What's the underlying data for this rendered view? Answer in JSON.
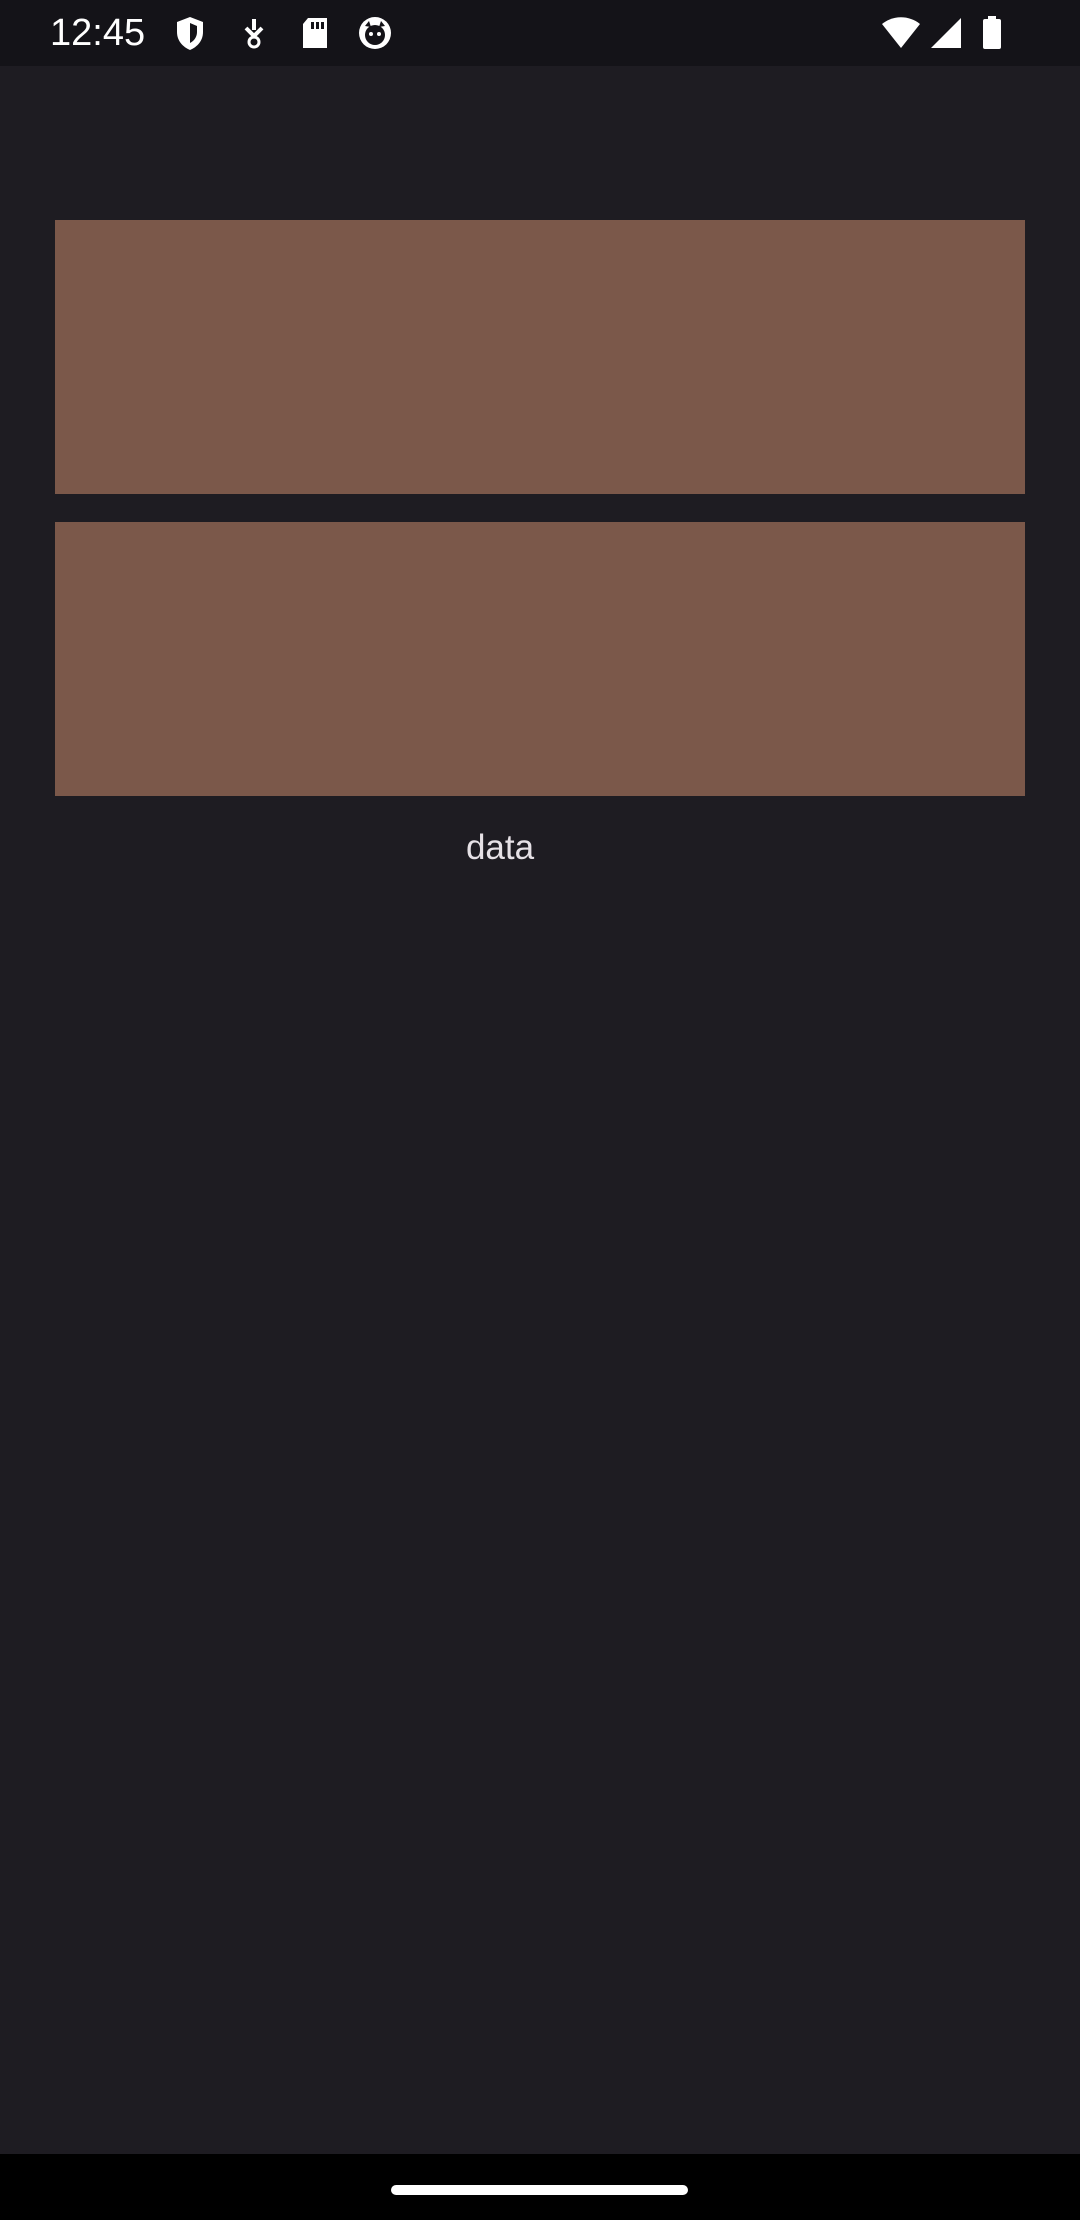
{
  "status_bar": {
    "time": "12:45",
    "left_icons": [
      "shield-icon",
      "download-icon",
      "sd-card-icon",
      "cat-face-icon"
    ],
    "right_icons": [
      "wifi-icon",
      "cellular-signal-icon",
      "battery-icon"
    ]
  },
  "main": {
    "label": "data"
  },
  "colors": {
    "background": "#1e1c22",
    "status_bar": "#141318",
    "card": "#7b584a",
    "nav_bar": "#000000",
    "text": "#e6e1e6"
  }
}
